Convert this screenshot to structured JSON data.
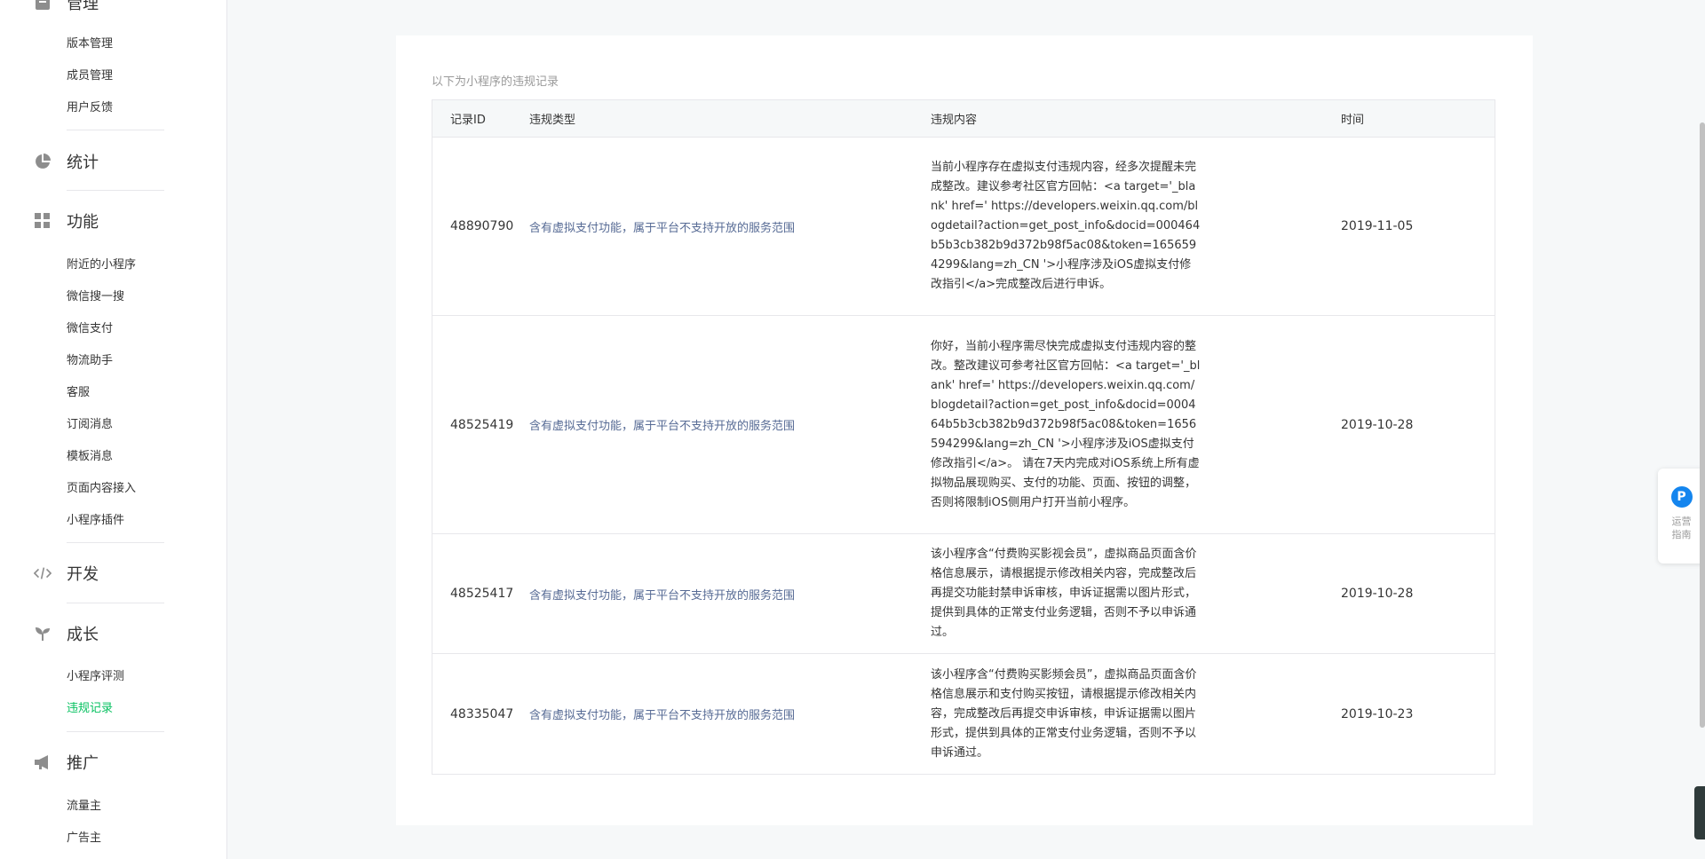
{
  "sidebar": {
    "sections": {
      "manage": {
        "title": "管理",
        "items": [
          "版本管理",
          "成员管理",
          "用户反馈"
        ]
      },
      "stats": {
        "title": "统计"
      },
      "features": {
        "title": "功能",
        "items": [
          "附近的小程序",
          "微信搜一搜",
          "微信支付",
          "物流助手",
          "客服",
          "订阅消息",
          "模板消息",
          "页面内容接入",
          "小程序插件"
        ]
      },
      "develop": {
        "title": "开发"
      },
      "growth": {
        "title": "成长",
        "items": [
          "小程序评测",
          "违规记录"
        ],
        "active": "违规记录"
      },
      "promote": {
        "title": "推广",
        "items": [
          "流量主",
          "广告主"
        ]
      }
    }
  },
  "main": {
    "caption": "以下为小程序的违规记录",
    "columns": [
      "记录ID",
      "违规类型",
      "违规内容",
      "时间"
    ],
    "rows": [
      {
        "id": "48890790",
        "type": "含有虚拟支付功能，属于平台不支持开放的服务范围",
        "content": "当前小程序存在虚拟支付违规内容，经多次提醒未完成整改。建议参考社区官方回帖：<a target='_blank' href=' https://developers.weixin.qq.com/blogdetail?action=get_post_info&docid=000464b5b3cb382b9d372b98f5ac08&token=1656594299&lang=zh_CN '>小程序涉及iOS虚拟支付修改指引</a>完成整改后进行申诉。",
        "time": "2019-11-05"
      },
      {
        "id": "48525419",
        "type": "含有虚拟支付功能，属于平台不支持开放的服务范围",
        "content": "你好，当前小程序需尽快完成虚拟支付违规内容的整改。整改建议可参考社区官方回帖：<a target='_blank' href=' https://developers.weixin.qq.com/blogdetail?action=get_post_info&docid=000464b5b3cb382b9d372b98f5ac08&token=1656594299&lang=zh_CN '>小程序涉及iOS虚拟支付修改指引</a>。 请在7天内完成对iOS系统上所有虚拟物品展现购买、支付的功能、页面、按钮的调整，否则将限制iOS侧用户打开当前小程序。",
        "time": "2019-10-28"
      },
      {
        "id": "48525417",
        "type": "含有虚拟支付功能，属于平台不支持开放的服务范围",
        "content": "该小程序含“付费购买影视会员”，虚拟商品页面含价格信息展示，请根据提示修改相关内容，完成整改后再提交功能封禁申诉审核，申诉证据需以图片形式，提供到具体的正常支付业务逻辑，否则不予以申诉通过。",
        "time": "2019-10-28"
      },
      {
        "id": "48335047",
        "type": "含有虚拟支付功能，属于平台不支持开放的服务范围",
        "content": "该小程序含“付费购买影频会员”，虚拟商品页面含价格信息展示和支付购买按钮，请根据提示修改相关内容，完成整改后再提交申诉审核，申诉证据需以图片形式，提供到具体的正常支付业务逻辑，否则不予以申诉通过。",
        "time": "2019-10-23"
      }
    ]
  },
  "float_panel": {
    "badge": "P",
    "label_line1": "运营",
    "label_line2": "指南"
  },
  "colors": {
    "accent_green": "#07c160",
    "link_blue": "#576b95",
    "badge_blue": "#1485ee"
  }
}
